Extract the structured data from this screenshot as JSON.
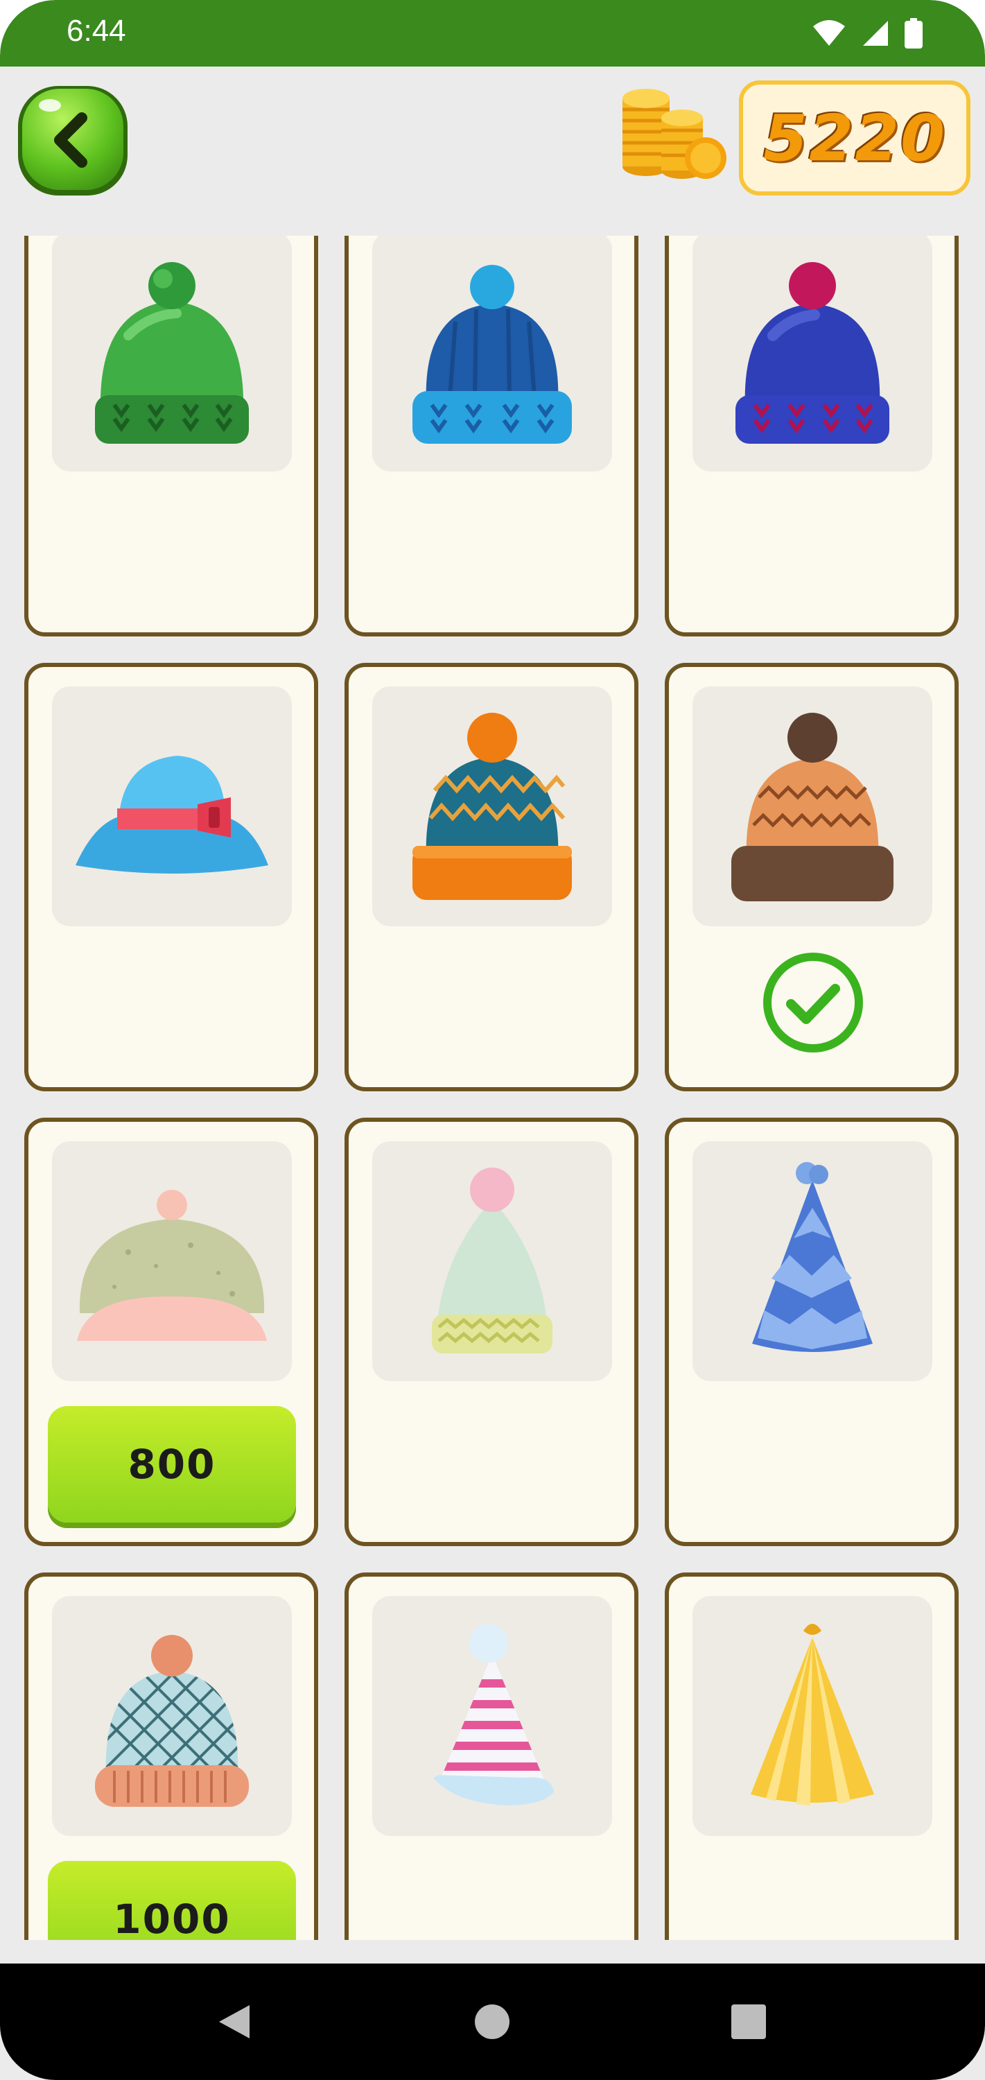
{
  "status": {
    "time": "6:44"
  },
  "header": {
    "coins": "5220"
  },
  "items": [
    {
      "hat": "green-beanie",
      "state": "owned"
    },
    {
      "hat": "blue-beanie",
      "state": "owned"
    },
    {
      "hat": "indigo-beanie",
      "state": "owned"
    },
    {
      "hat": "blue-bucket-hat",
      "state": "owned"
    },
    {
      "hat": "teal-orange-beanie",
      "state": "owned"
    },
    {
      "hat": "brown-beanie",
      "state": "selected"
    },
    {
      "hat": "sage-pink-cap",
      "state": "locked",
      "price": "800"
    },
    {
      "hat": "mint-pom-hat",
      "state": "owned"
    },
    {
      "hat": "blue-party-hat",
      "state": "owned"
    },
    {
      "hat": "netted-beanie",
      "state": "locked",
      "price": "1000"
    },
    {
      "hat": "pink-striped-hat",
      "state": "owned"
    },
    {
      "hat": "yellow-party-hat",
      "state": "owned"
    }
  ],
  "colors": {
    "accent": "#3a8a1e",
    "card_border": "#6d5420",
    "coin_text": "#f39a0b"
  }
}
